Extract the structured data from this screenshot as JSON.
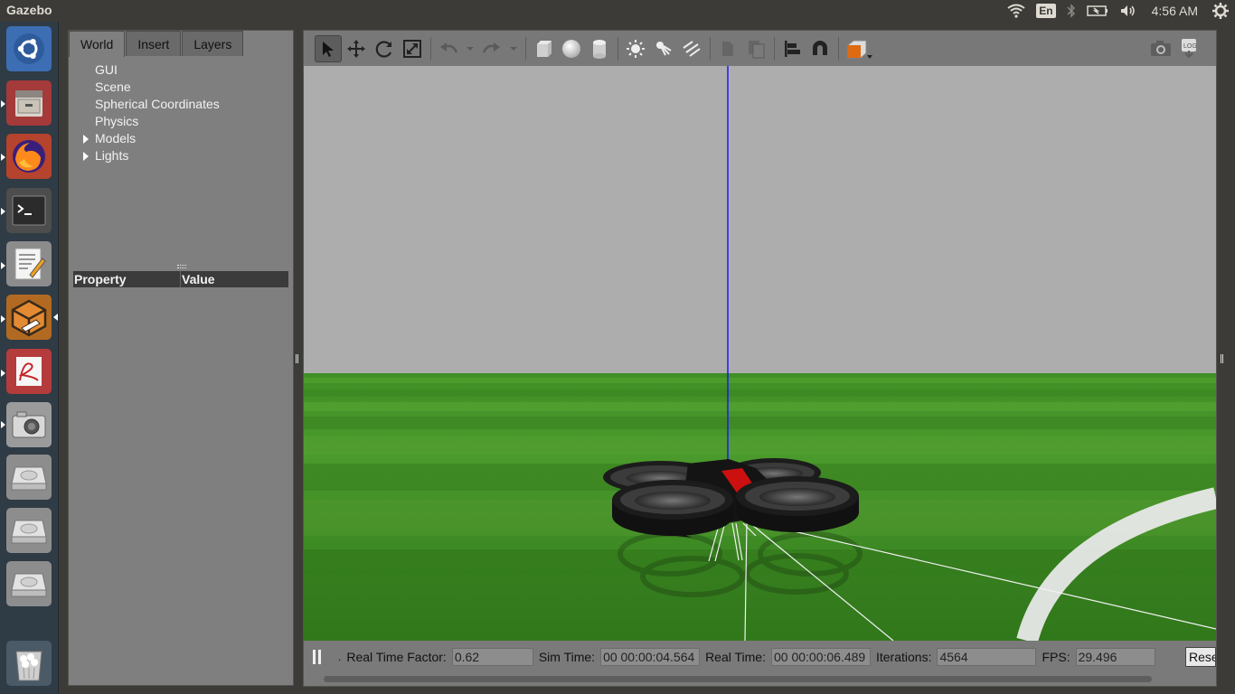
{
  "topbar": {
    "app_title": "Gazebo",
    "keyboard_layout": "En",
    "clock": "4:56 AM"
  },
  "launcher": {
    "items": [
      {
        "name": "ubuntu-dash-icon"
      },
      {
        "name": "files-icon"
      },
      {
        "name": "firefox-icon"
      },
      {
        "name": "terminal-icon"
      },
      {
        "name": "text-editor-icon"
      },
      {
        "name": "gazebo-icon"
      },
      {
        "name": "document-viewer-icon"
      },
      {
        "name": "camera-icon"
      },
      {
        "name": "drive-icon"
      },
      {
        "name": "drive-icon"
      },
      {
        "name": "drive-icon"
      },
      {
        "name": "trash-icon"
      }
    ]
  },
  "left_panel": {
    "tabs": [
      {
        "label": "World",
        "active": true
      },
      {
        "label": "Insert",
        "active": false
      },
      {
        "label": "Layers",
        "active": false
      }
    ],
    "tree": [
      {
        "label": "GUI",
        "expandable": false
      },
      {
        "label": "Scene",
        "expandable": false
      },
      {
        "label": "Spherical Coordinates",
        "expandable": false
      },
      {
        "label": "Physics",
        "expandable": false
      },
      {
        "label": "Models",
        "expandable": true
      },
      {
        "label": "Lights",
        "expandable": true
      }
    ],
    "property_header": {
      "property": "Property",
      "value": "Value"
    }
  },
  "toolbar": {
    "tools": [
      "select-mode-icon",
      "translate-mode-icon",
      "rotate-mode-icon",
      "scale-mode-icon",
      "undo-icon",
      "undo-history-icon",
      "redo-icon",
      "redo-history-icon",
      "box-icon",
      "sphere-icon",
      "cylinder-icon",
      "point-light-icon",
      "spot-light-icon",
      "directional-light-icon",
      "copy-icon",
      "paste-icon",
      "align-icon",
      "snap-icon",
      "view-angle-icon",
      "screenshot-icon",
      "log-icon"
    ]
  },
  "status": {
    "real_time_factor_label": "Real Time Factor:",
    "real_time_factor": "0.62",
    "sim_time_label": "Sim Time:",
    "sim_time": "00 00:00:04.564",
    "real_time_label": "Real Time:",
    "real_time": "00 00:00:06.489",
    "iterations_label": "Iterations:",
    "iterations": "4564",
    "fps_label": "FPS:",
    "fps": "29.496",
    "reset_label": "Reset",
    "step_marker": "."
  },
  "colors": {
    "sky": "#adadad",
    "grass": "#3d8c23",
    "drone_body": "#1c1c1c",
    "drone_accent": "#cc1010",
    "z_axis": "#1a1aff"
  }
}
